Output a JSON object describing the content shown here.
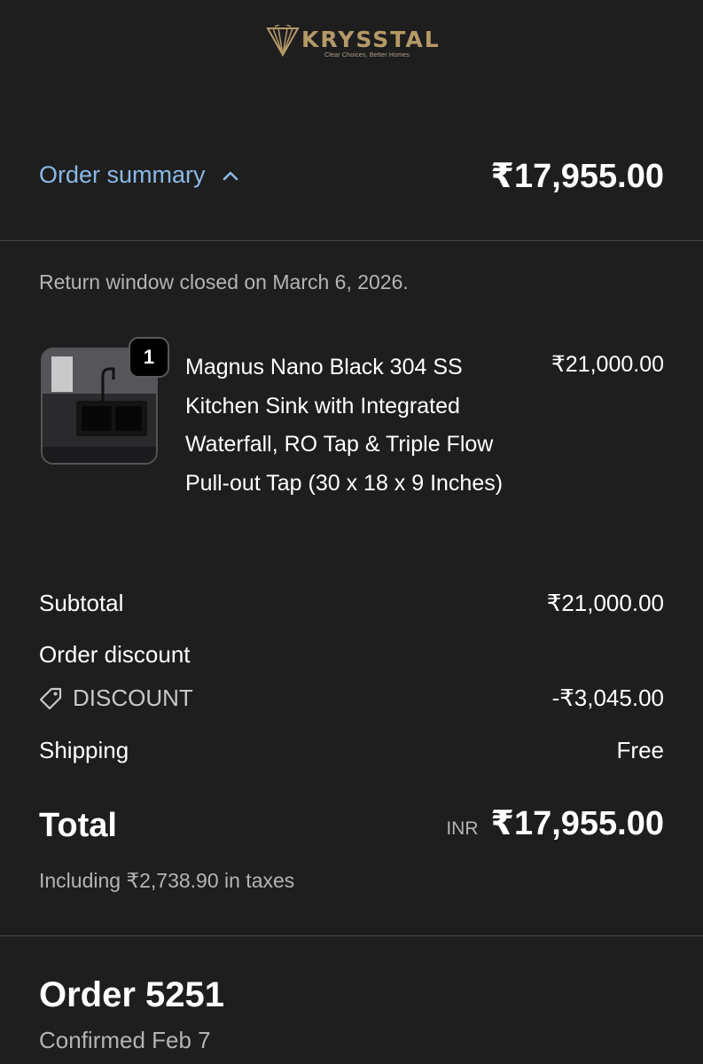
{
  "brand": {
    "name": "KRYSSTAL",
    "tagline": "Clear Choices, Better Homes",
    "gold": "#b59a67"
  },
  "summary": {
    "toggle_label": "Order summary",
    "toggle_icon": "chevron-up-icon",
    "total": "₹17,955.00",
    "link_color": "#8ab9e6"
  },
  "return_note": "Return window closed on March 6, 2026.",
  "product": {
    "quantity": "1",
    "title": "Magnus Nano Black 304 SS Kitchen Sink with Integrated Waterfall, RO Tap & Triple Flow Pull-out Tap (30 x 18 x 9 Inches)",
    "price": "₹21,000.00",
    "image_icon": "product-thumbnail"
  },
  "totals": {
    "subtotal_label": "Subtotal",
    "subtotal_value": "₹21,000.00",
    "discount_label": "Order discount",
    "discount_code": "DISCOUNT",
    "discount_icon": "tag-icon",
    "discount_value": "-₹3,045.00",
    "shipping_label": "Shipping",
    "shipping_value": "Free",
    "total_label": "Total",
    "currency": "INR",
    "total_value": "₹17,955.00",
    "taxes_note": "Including ₹2,738.90 in taxes"
  },
  "order": {
    "number": "Order 5251",
    "status": "Confirmed Feb 7"
  }
}
